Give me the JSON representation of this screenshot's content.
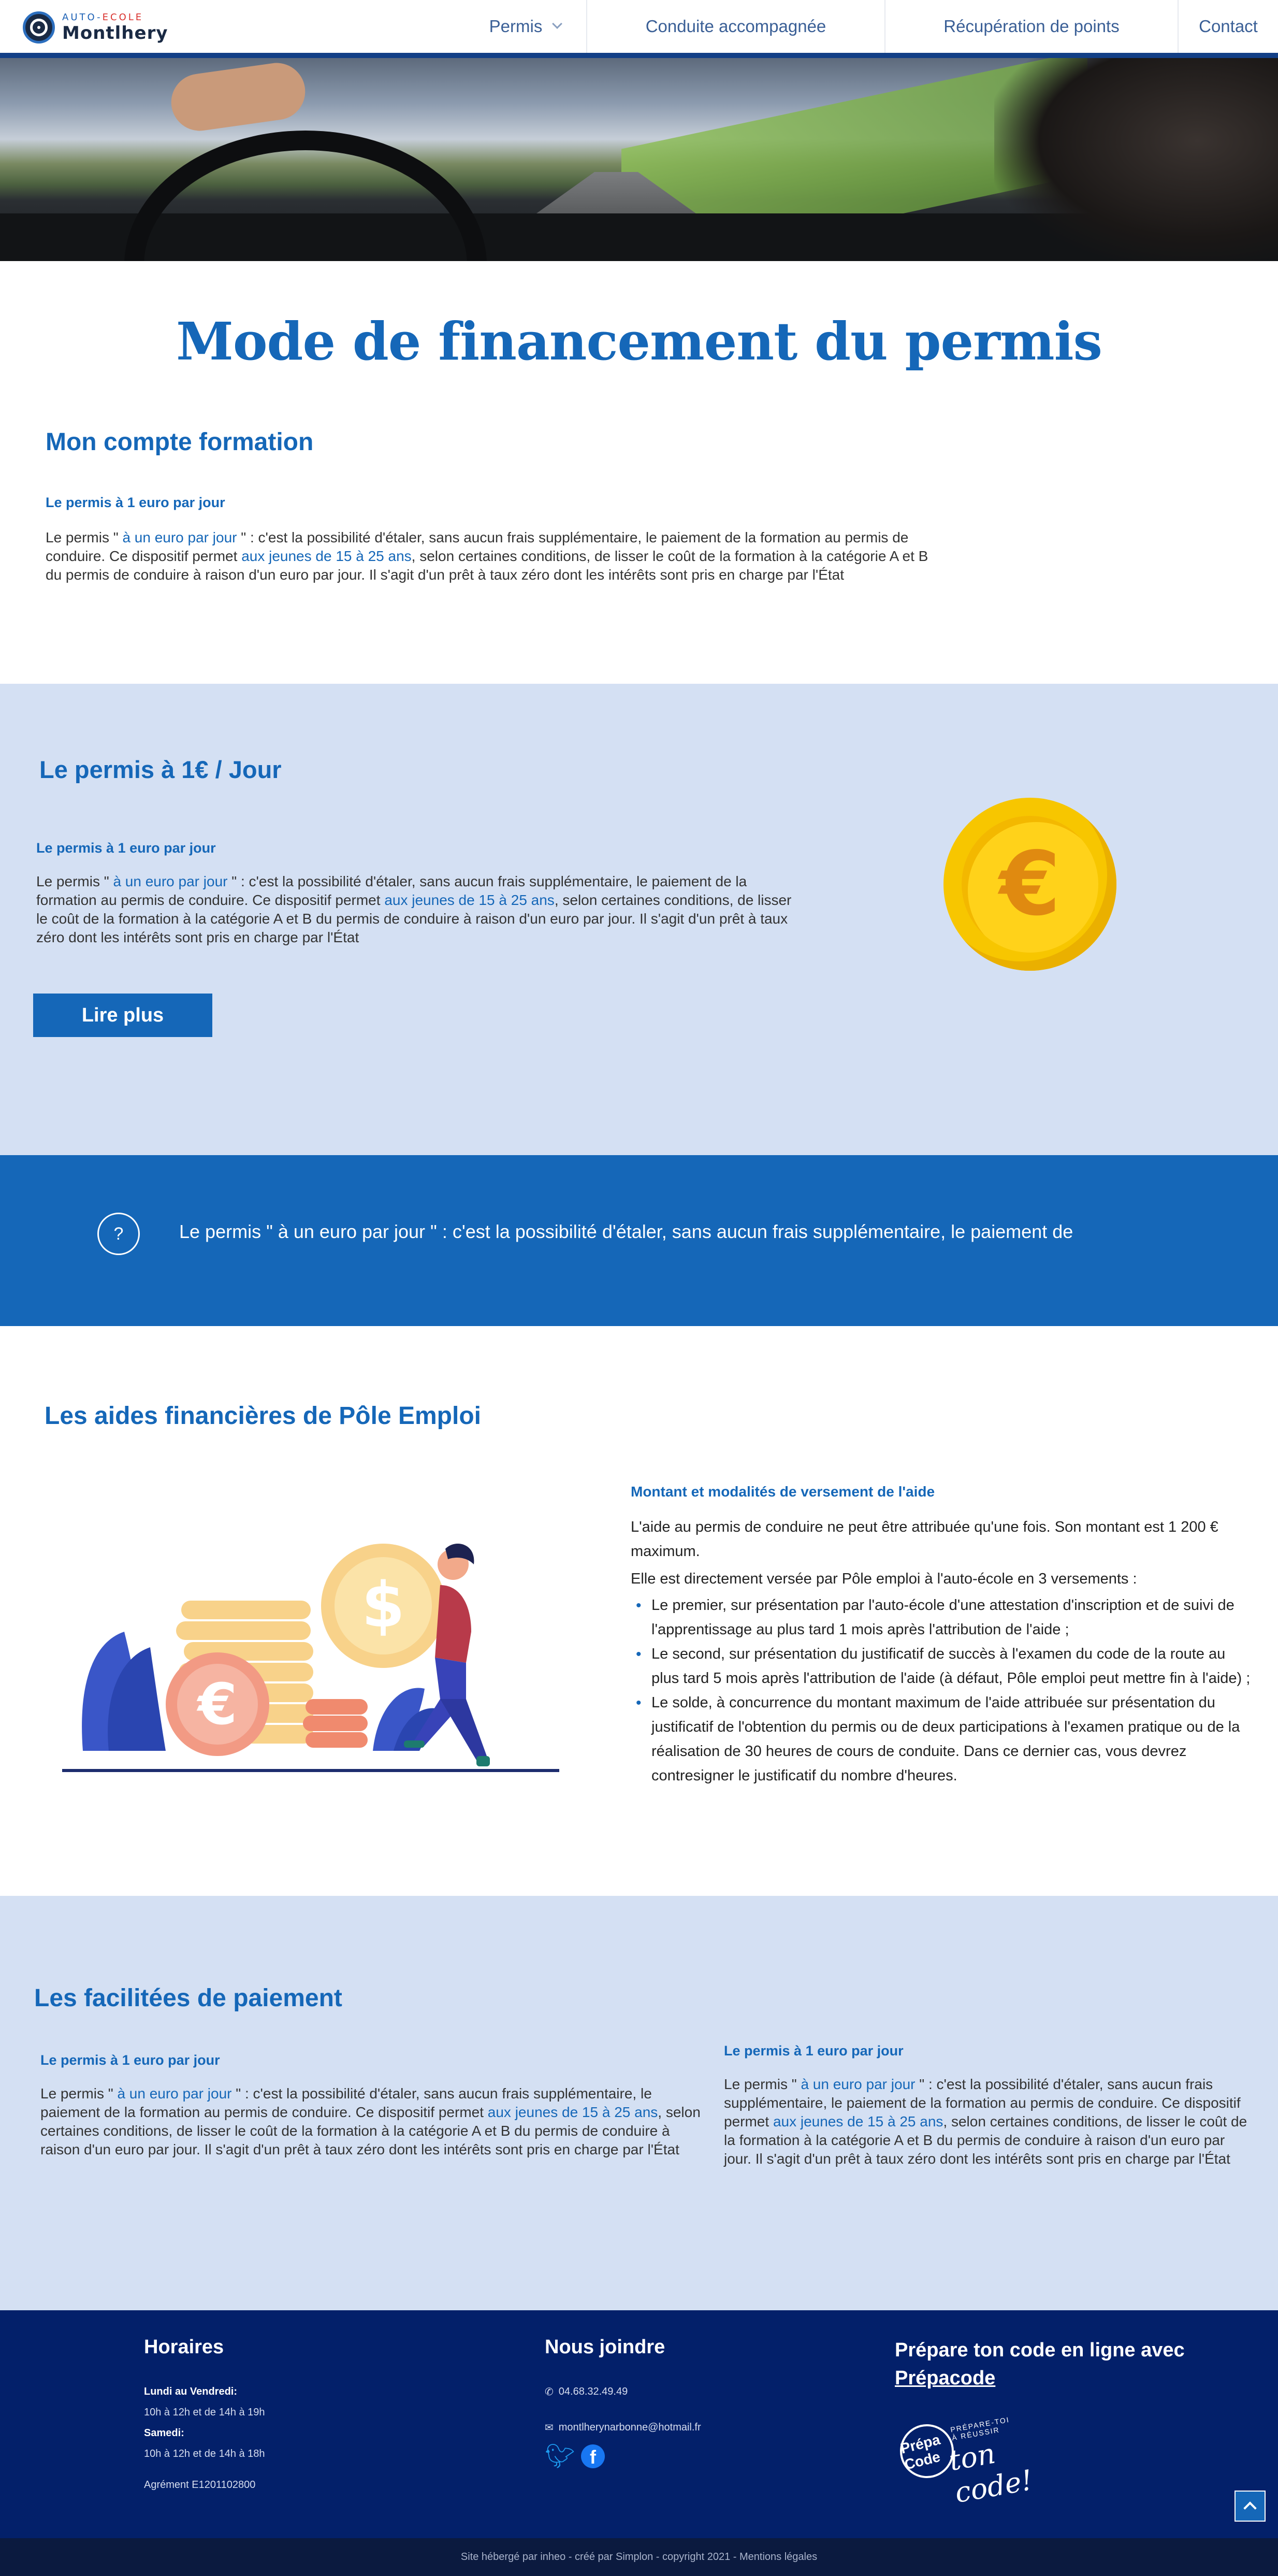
{
  "nav": {
    "logo_top_a": "AUTO-",
    "logo_top_b": "ECOLE",
    "logo_bottom": "Montlhery",
    "items": [
      {
        "label": "Permis",
        "dropdown": true
      },
      {
        "label": "Conduite accompagnée"
      },
      {
        "label": "Récupération de points"
      },
      {
        "label": "Contact"
      }
    ]
  },
  "page_title": "Mode de financement du permis",
  "section1": {
    "heading": "Mon compte formation",
    "subheading": "Le permis à 1 euro par jour",
    "p_a": "Le permis \" ",
    "p_hl1": "à un euro par jour",
    "p_b": " \" : c'est la possibilité d'étaler, sans aucun frais supplémentaire, le paiement de la formation au permis de conduire. Ce dispositif permet ",
    "p_hl2": "aux jeunes de 15 à 25 ans",
    "p_c": ", selon certaines conditions, de lisser le coût de la formation à la catégorie A et B du permis de conduire à raison d'un euro par jour. Il s'agit d'un prêt à taux zéro dont les intérêts sont pris en charge par l'État"
  },
  "section2": {
    "heading": "Le permis à 1€ / Jour",
    "subheading": "Le permis à 1 euro par jour",
    "p_a": "Le permis \" ",
    "p_hl1": "à un euro par jour",
    "p_b": " \" : c'est la possibilité d'étaler, sans aucun frais supplémentaire, le paiement de la formation au permis de conduire. Ce dispositif permet ",
    "p_hl2": "aux jeunes de 15 à 25 ans",
    "p_c": ", selon certaines conditions, de lisser le coût de la formation à la catégorie A et B du permis de conduire à raison d'un euro par jour. Il s'agit d'un prêt à taux zéro dont les intérêts sont pris en charge par l'État",
    "button": "Lire plus",
    "coin_symbol": "€"
  },
  "section3": {
    "icon": "?",
    "text": "Le permis \" à un euro par jour \" : c'est la possibilité d'étaler, sans aucun frais supplémentaire, le paiement de"
  },
  "section4": {
    "heading": "Les aides financières de Pôle Emploi",
    "subheading": "Montant et modalités de versement de l'aide",
    "p1": "L'aide au permis de conduire ne peut être attribuée qu'une fois. Son montant est 1 200 € maximum.",
    "p2": "Elle est directement versée par Pôle emploi à l'auto-école en 3 versements :",
    "bullets": [
      "Le premier, sur présentation par l'auto-école d'une attestation d'inscription et de suivi de l'apprentissage au plus tard 1 mois après l'attribution de l'aide ;",
      "Le second, sur présentation du justificatif de succès à l'examen du code de la route au plus tard 5 mois après l'attribution de l'aide (à défaut, Pôle emploi peut mettre fin à l'aide) ;",
      "Le solde, à concurrence du montant maximum de l'aide attribuée sur présentation du justificatif de l'obtention du permis ou de deux participations à l'examen pratique ou de la réalisation de 30 heures de cours de conduite. Dans ce dernier cas, vous devrez contresigner le justificatif du nombre d'heures."
    ]
  },
  "section5": {
    "heading": "Les facilitées de paiement",
    "left": {
      "subheading": "Le permis à 1 euro par jour",
      "p_a": "Le permis \" ",
      "p_hl1": "à un euro par jour",
      "p_b": " \" : c'est la possibilité d'étaler, sans aucun frais supplémentaire, le paiement de la formation au permis de conduire. Ce dispositif permet ",
      "p_hl2": "aux jeunes de 15 à 25 ans",
      "p_c": ", selon certaines conditions, de lisser le coût de la formation à la catégorie A et B du permis de conduire à raison d'un euro par jour. Il s'agit d'un prêt à taux zéro dont les intérêts sont pris en charge par l'État"
    },
    "right": {
      "subheading": "Le permis à 1 euro par jour",
      "p_a": "Le permis \" ",
      "p_hl1": "à un euro par jour",
      "p_b": " \" : c'est la possibilité d'étaler, sans aucun frais supplémentaire, le paiement de la formation au permis de conduire. Ce dispositif permet ",
      "p_hl2": "aux jeunes de 15 à 25 ans",
      "p_c": ", selon certaines conditions, de lisser le coût de la formation à la catégorie A et B du permis de conduire à raison d'un euro par jour. Il s'agit d'un prêt à taux zéro dont les intérêts sont pris en charge par l'État"
    }
  },
  "footer": {
    "hours_title": "Horaires",
    "weekday_label": "Lundi au Vendredi:",
    "weekday_hours": "10h à 12h et de 14h à 19h",
    "saturday_label": "Samedi:",
    "saturday_hours": "10h à 12h et de 14h à 18h",
    "agrement": "Agrément E1201102800",
    "contact_title": "Nous joindre",
    "phone": "04.68.32.49.49",
    "email": "montlherynarbonne@hotmail.fr",
    "prepa_title": "Prépare ton code en ligne avec",
    "prepa_link": "Prépacode",
    "prepa_logo_circle": "Prépa Code",
    "prepa_logo_small": "PRÉPARE-TOI À RÉUSSIR",
    "prepa_logo_code": "ton code!",
    "bottom": "Site hébergé par inheo - créé par Simplon - copyright 2021 - Mentions légales"
  }
}
